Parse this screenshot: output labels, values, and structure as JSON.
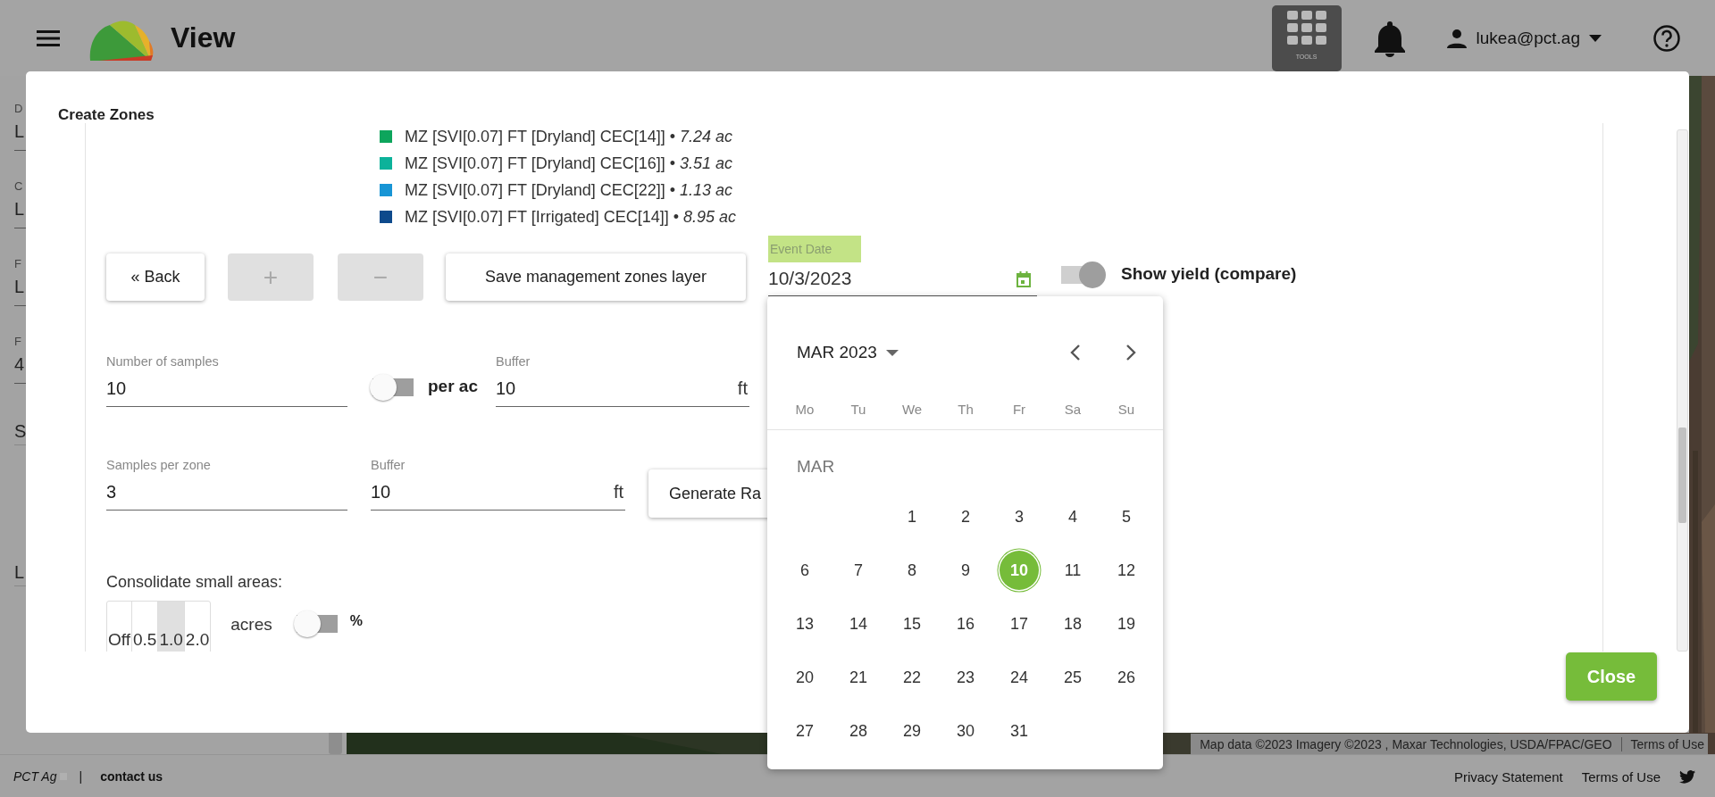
{
  "topbar": {
    "title": "View",
    "tools_label": "TOOLS",
    "user": "lukea@pct.ag"
  },
  "sidebar": {
    "items": [
      {
        "kind": "field",
        "label": "D",
        "value": "L"
      },
      {
        "kind": "field",
        "label": "C",
        "value": "L"
      },
      {
        "kind": "field",
        "label": "F",
        "value": "L"
      },
      {
        "kind": "field",
        "label": "F",
        "value": "4"
      },
      {
        "kind": "row",
        "value": "S"
      },
      {
        "kind": "row",
        "value": "L"
      }
    ]
  },
  "dialog": {
    "title": "Create Zones",
    "legend": [
      {
        "color": "#0da55c",
        "text": "MZ [SVI[0.07] FT [Dryland] CEC[14]] • *7.24 ac*"
      },
      {
        "color": "#0cb29a",
        "text": "MZ [SVI[0.07] FT [Dryland] CEC[16]] • *3.51 ac*"
      },
      {
        "color": "#1895d5",
        "text": "MZ [SVI[0.07] FT [Dryland] CEC[22]] • *1.13 ac*"
      },
      {
        "color": "#0e4a8c",
        "text": "MZ [SVI[0.07] FT [Irrigated] CEC[14]] • *8.95 ac*"
      }
    ],
    "buttons": [
      {
        "label": "« Back",
        "disabled": false
      },
      {
        "label": "+",
        "disabled": true
      },
      {
        "label": "−",
        "disabled": true
      },
      {
        "label": "Save management zones layer",
        "disabled": false
      }
    ],
    "event_date": {
      "label": "Event Date",
      "value": "10/3/2023"
    },
    "show_yield": {
      "label": "Show yield (compare)",
      "on": true
    },
    "number_of_samples": {
      "label": "Number of samples",
      "value": "10"
    },
    "per_ac": {
      "label": "per ac",
      "on": false
    },
    "buffer_1": {
      "label": "Buffer",
      "value": "10",
      "unit": "ft"
    },
    "samples_per_zone": {
      "label": "Samples per zone",
      "value": "3"
    },
    "buffer_2": {
      "label": "Buffer",
      "value": "10",
      "unit": "ft"
    },
    "generate_button": "Generate Ra",
    "consolidate": {
      "label": "Consolidate small areas:",
      "options": [
        {
          "label": "Off",
          "selected": false
        },
        {
          "label": "0.5",
          "selected": false
        },
        {
          "label": "1.0",
          "selected": true
        },
        {
          "label": "2.0",
          "selected": false
        }
      ],
      "unit": "acres",
      "percent": {
        "label": "%",
        "on": false
      }
    },
    "close": "Close"
  },
  "calendar": {
    "month_label": "MAR 2023",
    "weekdays": [
      "Mo",
      "Tu",
      "We",
      "Th",
      "Fr",
      "Sa",
      "Su"
    ],
    "section_label": "MAR",
    "weeks": [
      {
        "kind": "first",
        "days": [
          {
            "label": "1",
            "selected": false
          },
          {
            "label": "2",
            "selected": false
          },
          {
            "label": "3",
            "selected": false
          },
          {
            "label": "4",
            "selected": false
          },
          {
            "label": "5",
            "selected": false
          }
        ]
      },
      {
        "kind": "full",
        "days": [
          {
            "label": "6",
            "selected": false
          },
          {
            "label": "7",
            "selected": false
          },
          {
            "label": "8",
            "selected": false
          },
          {
            "label": "9",
            "selected": false
          },
          {
            "label": "10",
            "selected": true
          },
          {
            "label": "11",
            "selected": false
          },
          {
            "label": "12",
            "selected": false
          }
        ]
      },
      {
        "kind": "full",
        "days": [
          {
            "label": "13",
            "selected": false
          },
          {
            "label": "14",
            "selected": false
          },
          {
            "label": "15",
            "selected": false
          },
          {
            "label": "16",
            "selected": false
          },
          {
            "label": "17",
            "selected": false
          },
          {
            "label": "18",
            "selected": false
          },
          {
            "label": "19",
            "selected": false
          }
        ]
      },
      {
        "kind": "full",
        "days": [
          {
            "label": "20",
            "selected": false
          },
          {
            "label": "21",
            "selected": false
          },
          {
            "label": "22",
            "selected": false
          },
          {
            "label": "23",
            "selected": false
          },
          {
            "label": "24",
            "selected": false
          },
          {
            "label": "25",
            "selected": false
          },
          {
            "label": "26",
            "selected": false
          }
        ]
      },
      {
        "kind": "last",
        "days": [
          {
            "label": "27",
            "selected": false
          },
          {
            "label": "28",
            "selected": false
          },
          {
            "label": "29",
            "selected": false
          },
          {
            "label": "30",
            "selected": false
          },
          {
            "label": "31",
            "selected": false
          }
        ]
      }
    ]
  },
  "map": {
    "attribution": "Map data ©2023 Imagery ©2023 , Maxar Technologies, USDA/FPAC/GEO",
    "terms": "Terms of Use"
  },
  "footer": {
    "brand": "PCT Ag",
    "separator": "|",
    "contact": "contact us",
    "links": [
      "Privacy Statement",
      "Terms of Use"
    ]
  }
}
